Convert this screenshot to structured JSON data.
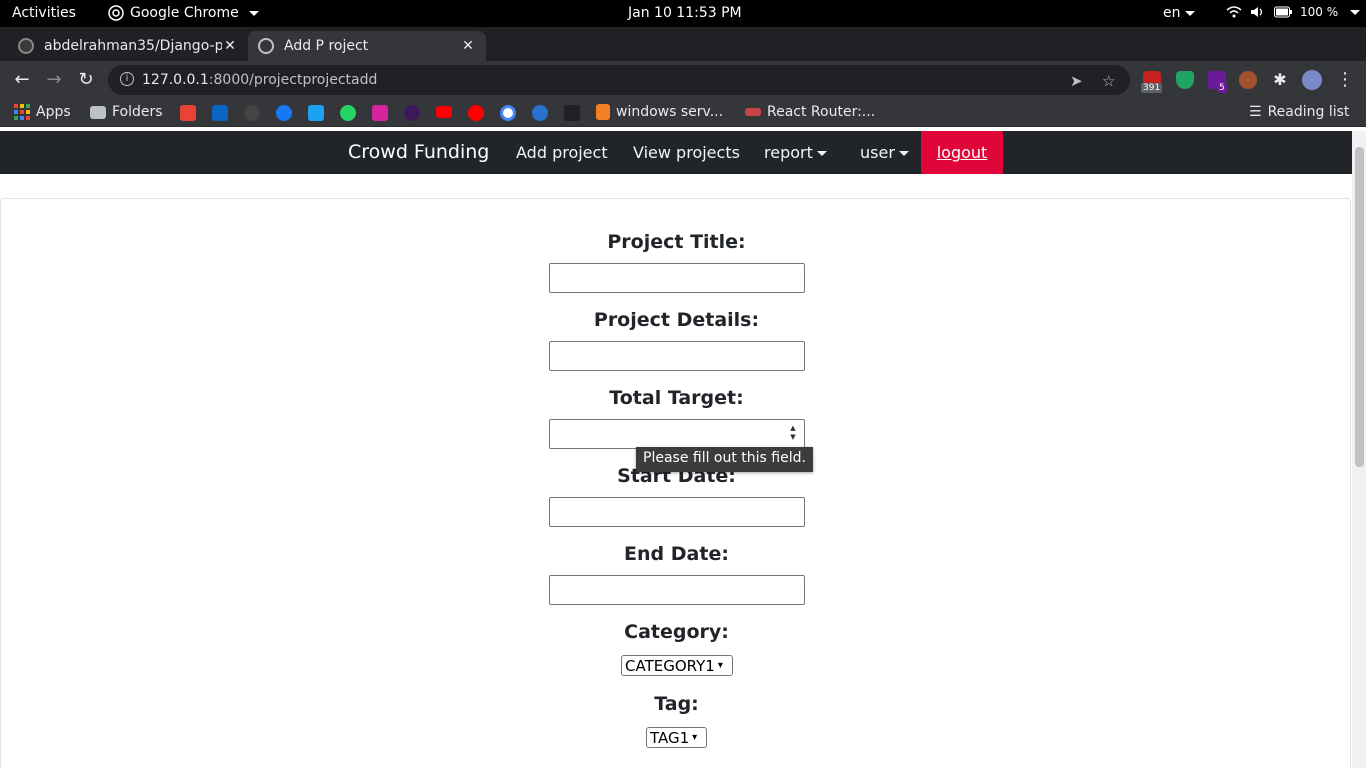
{
  "system_bar": {
    "activities": "Activities",
    "app": "Google Chrome",
    "clock": "Jan 10  11:53 PM",
    "language": "en",
    "battery": "100 %"
  },
  "browser": {
    "tabs": [
      {
        "label": "abdelrahman35/Django-p",
        "active": false
      },
      {
        "label": "Add P roject",
        "active": true
      }
    ],
    "url_host": "127.0.0.1",
    "url_rest": ":8000/projectprojectadd",
    "extension_badges": {
      "gmail": "391",
      "ext5": "5"
    },
    "bookmarks": {
      "apps": "Apps",
      "folders": "Folders",
      "windows": "windows serv...",
      "react": "React Router:...",
      "reading_list": "Reading list"
    }
  },
  "site_nav": {
    "brand": "Crowd Funding",
    "add_project": "Add project",
    "view_projects": "View projects",
    "report": "report",
    "user": "user",
    "logout": "logout"
  },
  "form": {
    "title_label": "Project Title:",
    "details_label": "Project Details:",
    "target_label": "Total Target:",
    "start_label": "Start Date:",
    "end_label": "End Date:",
    "category_label": "Category:",
    "category_value": "CATEGORY1",
    "tag_label": "Tag:",
    "tag_value": "TAG1"
  },
  "tooltip": "Please fill out this field.",
  "colors": {
    "nav_bg": "#212529",
    "logout_bg": "#e0063a",
    "chrome_dark": "#202124",
    "chrome_toolbar": "#35363a"
  }
}
